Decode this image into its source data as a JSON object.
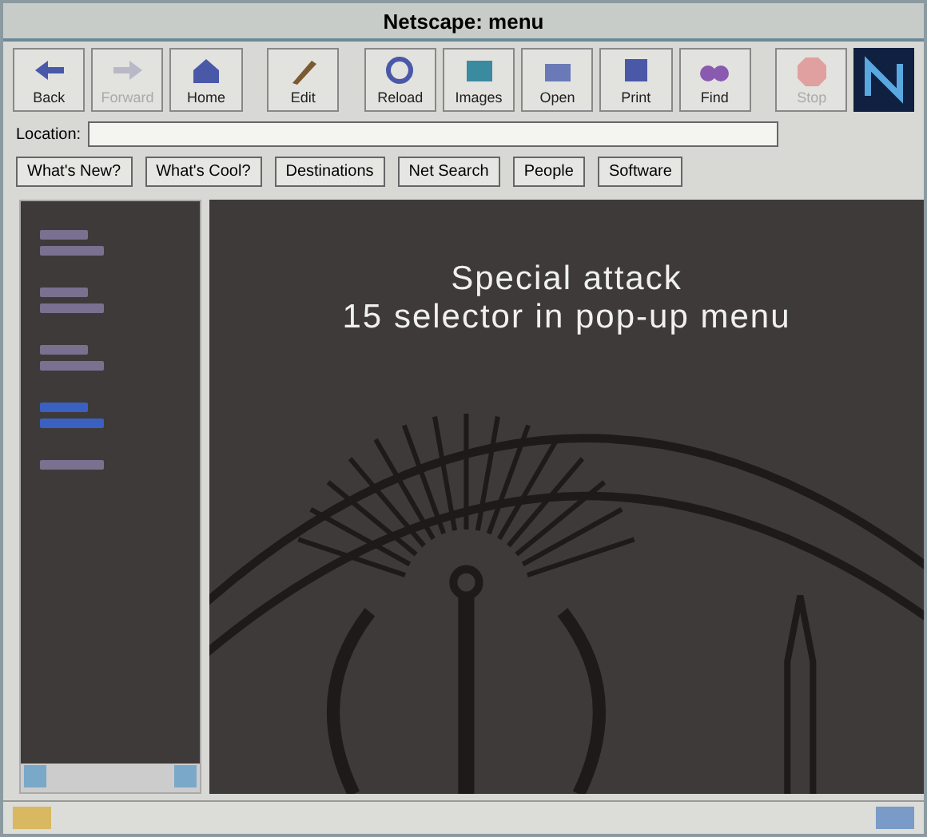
{
  "window": {
    "title": "Netscape: menu"
  },
  "toolbar": [
    {
      "label": "Back",
      "disabled": false
    },
    {
      "label": "Forward",
      "disabled": true
    },
    {
      "label": "Home",
      "disabled": false
    },
    {
      "label": "Edit",
      "disabled": false
    },
    {
      "label": "Reload",
      "disabled": false
    },
    {
      "label": "Images",
      "disabled": false
    },
    {
      "label": "Open",
      "disabled": false
    },
    {
      "label": "Print",
      "disabled": false
    },
    {
      "label": "Find",
      "disabled": false
    },
    {
      "label": "Stop",
      "disabled": true
    }
  ],
  "location": {
    "label": "Location:"
  },
  "directory_buttons": [
    "What's New?",
    "What's Cool?",
    "Destinations",
    "Net Search",
    "People",
    "Software"
  ],
  "sidebar": {
    "links": [
      {
        "kind": "two-line",
        "selected": false
      },
      {
        "kind": "two-line",
        "selected": false
      },
      {
        "kind": "two-line",
        "selected": false
      },
      {
        "kind": "two-line",
        "selected": true
      },
      {
        "kind": "one-line",
        "selected": false
      }
    ]
  },
  "content": {
    "heading": [
      "Special attack",
      "15 selector in pop-up menu"
    ]
  }
}
